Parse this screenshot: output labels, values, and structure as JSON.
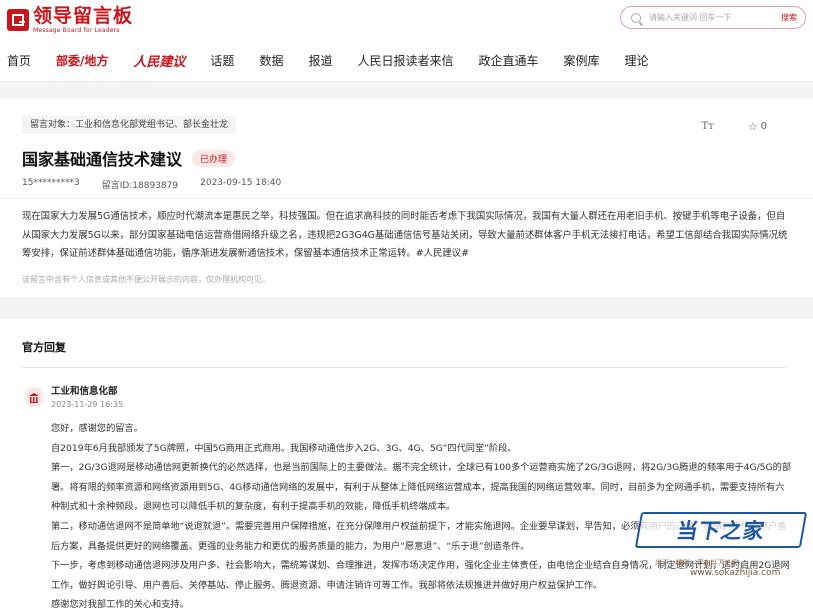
{
  "header": {
    "logo_cn": "领导留言板",
    "logo_en": "Message Board for Leaders",
    "search_placeholder": "请输入关键词 回车一下",
    "search_button": "搜索"
  },
  "nav": {
    "items": [
      {
        "label": "首页",
        "active": false
      },
      {
        "label": "部委/地方",
        "active": true
      },
      {
        "label": "人民建议",
        "active": false,
        "brand": true
      },
      {
        "label": "话题",
        "active": false
      },
      {
        "label": "数据",
        "active": false
      },
      {
        "label": "报道",
        "active": false
      },
      {
        "label": "人民日报读者来信",
        "active": false
      },
      {
        "label": "政企直通车",
        "active": false
      },
      {
        "label": "案例库",
        "active": false
      },
      {
        "label": "理论",
        "active": false
      }
    ]
  },
  "message": {
    "target": "留言对象：工业和信息化部党组书记、部长金壮龙",
    "font_icon": "Tт",
    "favorites": "0",
    "title": "国家基础通信技术建议",
    "status": "已办理",
    "author": "15*********3",
    "message_id": "留言ID:18893879",
    "date": "2023-09-15 18:40",
    "body": "现在国家大力发展5G通信技术，顺应时代潮流本是惠民之举，科技强国。但在追求高科技的同时能否考虑下我国实际情况，我国有大量人群还在用老旧手机、按键手机等电子设备，但自从国家大力发展5G以来，部分国家基础电信运营商借网络升级之名，违规把2G3G4G基础通信信号基站关闭，导致大量前述群体客户手机无法接打电话，希望工信部结合我国实际情况统筹安排，保证前述群体基础通信功能，循序渐进发展新通信技术，保留基本通信技术正常运转。#人民建议#",
    "notice": "该留言中含有个人信息或其他不便公开展示的内容，仅办理机构可见。"
  },
  "reply": {
    "section_title": "官方回复",
    "org": "工业和信息化部",
    "time": "2023-11-29 16:35",
    "paragraphs": [
      "您好，感谢您的留言。",
      "自2019年6月我部颁发了5G牌照，中国5G商用正式商用。我国移动通信步入2G、3G、4G、5G“四代同堂”阶段。",
      "第一，2G/3G退网是移动通信网更新换代的必然选择，也是当前国际上的主要做法。据不完全统计，全球已有100多个运营商实施了2G/3G退网，将2G/3G腾退的频率用于4G/5G的部署。将有限的频率资源和网络资源用到5G、4G移动通信网络的发展中，有利于从整体上降低网络运营成本，提高我国的网络运营效率。同时，目前多为全网通手机，需要支持所有六种制式和十余种频段，退网也可以降低手机的复杂度，有利于提高手机的效能，降低手机终端成本。",
      "第二，移动通信退网不是简单地“说退就退”。需要完善用户保障措施，在充分保障用户权益前提下，才能实施退网。企业要早谋划，早告知，必须有用户的迁转、网络的优化和用户善后方案，具备提供更好的网络覆盖、更强的业务能力和更优的服务质量的能力，为用户“愿意退”、“乐于退”创造条件。",
      "下一步，考虑到移动通信退网涉及用户多、社会影响大，需统筹谋划、合理推进，发挥市场决定作用，强化企业主体责任，由电信企业结合自身情况，制定退网计划，适时启用2G退网工作，做好舆论引导、用户善后、关停基站、停止服务、腾退资源、申请注销许可等工作。我部将依法规推进并做好用户权益保护工作。",
      "感谢您对我部工作的关心和支持。"
    ]
  },
  "watermark": {
    "text": "当下之家",
    "sub": "当下 · 精彩 · 尽在当下之家",
    "url": "www.sokazhijia.com"
  },
  "colors": {
    "brand_red": "#c8161d",
    "badge_bg": "#fde8e8",
    "watermark_blue": "#1e56a0"
  }
}
